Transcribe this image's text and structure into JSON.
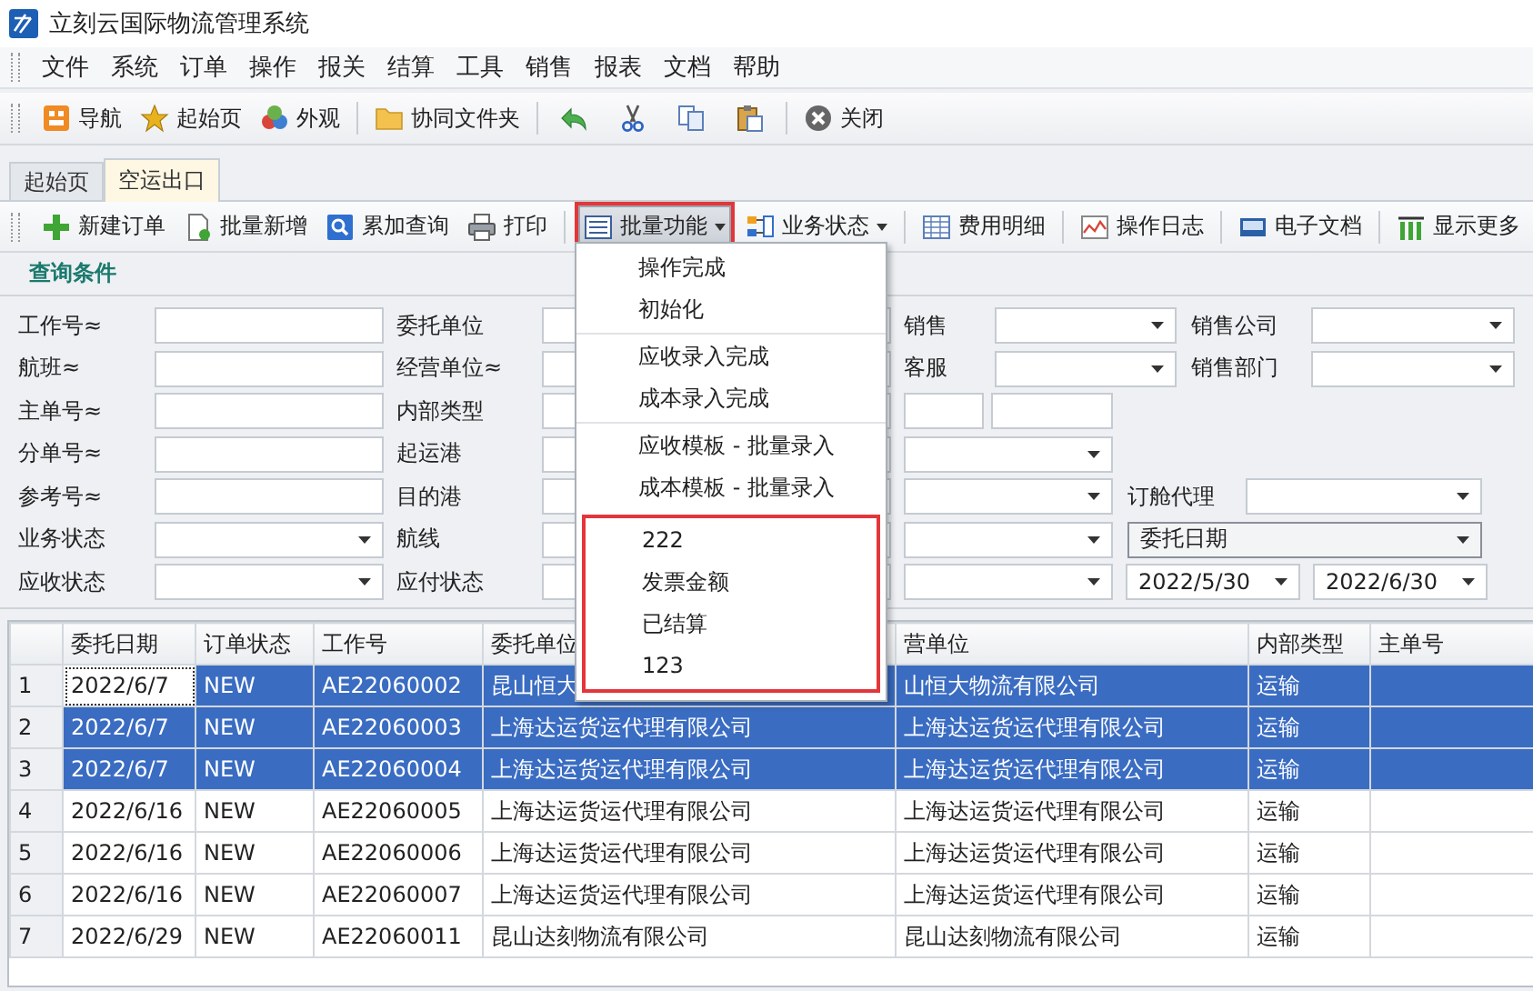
{
  "window": {
    "title": "立刻云国际物流管理系统"
  },
  "menu_bar": [
    "文件",
    "系统",
    "订单",
    "操作",
    "报关",
    "结算",
    "工具",
    "销售",
    "报表",
    "文档",
    "帮助"
  ],
  "toolbar": {
    "groups": [
      [
        {
          "kind": "button",
          "label": "导航"
        },
        {
          "kind": "button",
          "label": "起始页"
        },
        {
          "kind": "button",
          "label": "外观"
        }
      ],
      [
        {
          "kind": "button",
          "label": "协同文件夹"
        }
      ],
      [
        {
          "kind": "icon"
        },
        {
          "kind": "icon"
        },
        {
          "kind": "icon"
        },
        {
          "kind": "icon"
        }
      ],
      [
        {
          "kind": "button",
          "label": "关闭"
        }
      ]
    ]
  },
  "tabs": [
    {
      "label": "起始页",
      "selected": false
    },
    {
      "label": "空运出口",
      "selected": true
    }
  ],
  "action_bar": {
    "groups": [
      [
        {
          "label": "新建订单",
          "dropdown": false,
          "pressed": false,
          "highlighted": false
        },
        {
          "label": "批量新增",
          "dropdown": false,
          "pressed": false,
          "highlighted": false
        },
        {
          "label": "累加查询",
          "dropdown": false,
          "pressed": false,
          "highlighted": false
        },
        {
          "label": "打印",
          "dropdown": false,
          "pressed": false,
          "highlighted": false
        }
      ],
      [
        {
          "label": "批量功能",
          "dropdown": true,
          "pressed": true,
          "highlighted": true
        },
        {
          "label": "业务状态",
          "dropdown": true,
          "pressed": false,
          "highlighted": false
        }
      ],
      [
        {
          "label": "费用明细",
          "dropdown": false,
          "pressed": false,
          "highlighted": false
        }
      ],
      [
        {
          "label": "操作日志",
          "dropdown": false,
          "pressed": false,
          "highlighted": false
        }
      ],
      [
        {
          "label": "电子文档",
          "dropdown": false,
          "pressed": false,
          "highlighted": false
        }
      ],
      [
        {
          "label": "显示更多",
          "dropdown": false,
          "pressed": false,
          "highlighted": false
        }
      ]
    ]
  },
  "query_panel": {
    "title": "查询条件",
    "rows": [
      [
        {
          "kind": "label",
          "text": "工作号≈"
        },
        {
          "kind": "text"
        },
        {
          "kind": "label",
          "text": "委托单位"
        },
        {
          "kind": "text"
        },
        {
          "kind": "label",
          "text": "销售"
        },
        {
          "kind": "select"
        },
        {
          "kind": "label",
          "text": "销售公司"
        },
        {
          "kind": "select"
        }
      ],
      [
        {
          "kind": "label",
          "text": "航班≈"
        },
        {
          "kind": "text"
        },
        {
          "kind": "label",
          "text": "经营单位≈"
        },
        {
          "kind": "text"
        },
        {
          "kind": "label",
          "text": "客服"
        },
        {
          "kind": "select"
        },
        {
          "kind": "label",
          "text": "销售部门"
        },
        {
          "kind": "select"
        }
      ],
      [
        {
          "kind": "label",
          "text": "主单号≈"
        },
        {
          "kind": "text"
        },
        {
          "kind": "label",
          "text": "内部类型"
        },
        {
          "kind": "text"
        },
        {
          "kind": "pair"
        }
      ],
      [
        {
          "kind": "label",
          "text": "分单号≈"
        },
        {
          "kind": "text"
        },
        {
          "kind": "label",
          "text": "起运港"
        },
        {
          "kind": "text"
        },
        {
          "kind": "select"
        }
      ],
      [
        {
          "kind": "label",
          "text": "参考号≈"
        },
        {
          "kind": "text"
        },
        {
          "kind": "label",
          "text": "目的港"
        },
        {
          "kind": "text"
        },
        {
          "kind": "select"
        },
        {
          "kind": "label",
          "text": "订舱代理"
        },
        {
          "kind": "select"
        }
      ],
      [
        {
          "kind": "label",
          "text": "业务状态"
        },
        {
          "kind": "select"
        },
        {
          "kind": "label",
          "text": "航线"
        },
        {
          "kind": "text"
        },
        {
          "kind": "select"
        },
        {
          "kind": "combo",
          "value": "委托日期"
        }
      ],
      [
        {
          "kind": "label",
          "text": "应收状态"
        },
        {
          "kind": "select"
        },
        {
          "kind": "label",
          "text": "应付状态"
        },
        {
          "kind": "text"
        },
        {
          "kind": "select"
        },
        {
          "kind": "date",
          "value": "2022/5/30"
        },
        {
          "kind": "date",
          "value": "2022/6/30"
        }
      ]
    ]
  },
  "table": {
    "columns": [
      "委托日期",
      "订单状态",
      "工作号",
      "委托单位",
      "营单位",
      "内部类型",
      "主单号"
    ],
    "rows": [
      {
        "number": "1",
        "selected": true,
        "focused": true,
        "cells": [
          "2022/6/7",
          "NEW",
          "AE22060002",
          "昆山恒大",
          "山恒大物流有限公司",
          "运输"
        ]
      },
      {
        "number": "2",
        "selected": true,
        "focused": false,
        "cells": [
          "2022/6/7",
          "NEW",
          "AE22060003",
          "上海达运货运代理有限公司",
          "上海达运货运代理有限公司",
          "运输"
        ]
      },
      {
        "number": "3",
        "selected": true,
        "focused": false,
        "cells": [
          "2022/6/7",
          "NEW",
          "AE22060004",
          "上海达运货运代理有限公司",
          "上海达运货运代理有限公司",
          "运输"
        ]
      },
      {
        "number": "4",
        "selected": false,
        "focused": false,
        "cells": [
          "2022/6/16",
          "NEW",
          "AE22060005",
          "上海达运货运代理有限公司",
          "上海达运货运代理有限公司",
          "运输"
        ]
      },
      {
        "number": "5",
        "selected": false,
        "focused": false,
        "cells": [
          "2022/6/16",
          "NEW",
          "AE22060006",
          "上海达运货运代理有限公司",
          "上海达运货运代理有限公司",
          "运输"
        ]
      },
      {
        "number": "6",
        "selected": false,
        "focused": false,
        "cells": [
          "2022/6/16",
          "NEW",
          "AE22060007",
          "上海达运货运代理有限公司",
          "上海达运货运代理有限公司",
          "运输"
        ]
      },
      {
        "number": "7",
        "selected": false,
        "focused": false,
        "cells": [
          "2022/6/29",
          "NEW",
          "AE22060011",
          "昆山达刻物流有限公司",
          "昆山达刻物流有限公司",
          "运输"
        ]
      }
    ]
  },
  "dropdown_menu": {
    "groups": [
      {
        "highlighted": false,
        "items": [
          "操作完成",
          "初始化"
        ]
      },
      {
        "highlighted": false,
        "items": [
          "应收录入完成",
          "成本录入完成"
        ]
      },
      {
        "highlighted": false,
        "items": [
          "应收模板 - 批量录入",
          "成本模板 - 批量录入"
        ]
      },
      {
        "highlighted": true,
        "items": [
          "222",
          "发票金额",
          "已结算",
          "123"
        ]
      }
    ]
  }
}
